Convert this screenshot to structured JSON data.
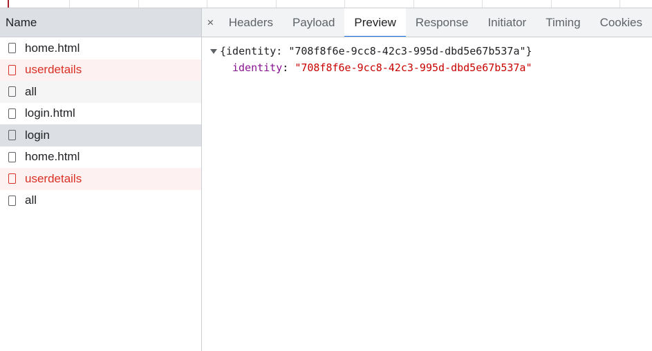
{
  "name_panel": {
    "header": "Name",
    "requests": [
      {
        "label": "home.html",
        "status": "ok"
      },
      {
        "label": "userdetails",
        "status": "error"
      },
      {
        "label": "all",
        "status": "ok"
      },
      {
        "label": "login.html",
        "status": "ok"
      },
      {
        "label": "login",
        "status": "selected"
      },
      {
        "label": "home.html",
        "status": "ok"
      },
      {
        "label": "userdetails",
        "status": "error"
      },
      {
        "label": "all",
        "status": "ok"
      }
    ]
  },
  "detail_panel": {
    "close_glyph": "×",
    "tabs": [
      {
        "label": "Headers",
        "active": false
      },
      {
        "label": "Payload",
        "active": false
      },
      {
        "label": "Preview",
        "active": true
      },
      {
        "label": "Response",
        "active": false
      },
      {
        "label": "Initiator",
        "active": false
      },
      {
        "label": "Timing",
        "active": false
      },
      {
        "label": "Cookies",
        "active": false
      }
    ],
    "preview": {
      "summary": "{identity: \"708f8f6e-9cc8-42c3-995d-dbd5e67b537a\"}",
      "property_key": "identity",
      "property_sep": ": ",
      "property_value": "\"708f8f6e-9cc8-42c3-995d-dbd5e67b537a\""
    }
  },
  "colors": {
    "accent": "#1a73e8",
    "error": "#d93025",
    "json_key": "#881391",
    "json_string": "#c80000",
    "timeline_marker": "#a61e2c"
  }
}
